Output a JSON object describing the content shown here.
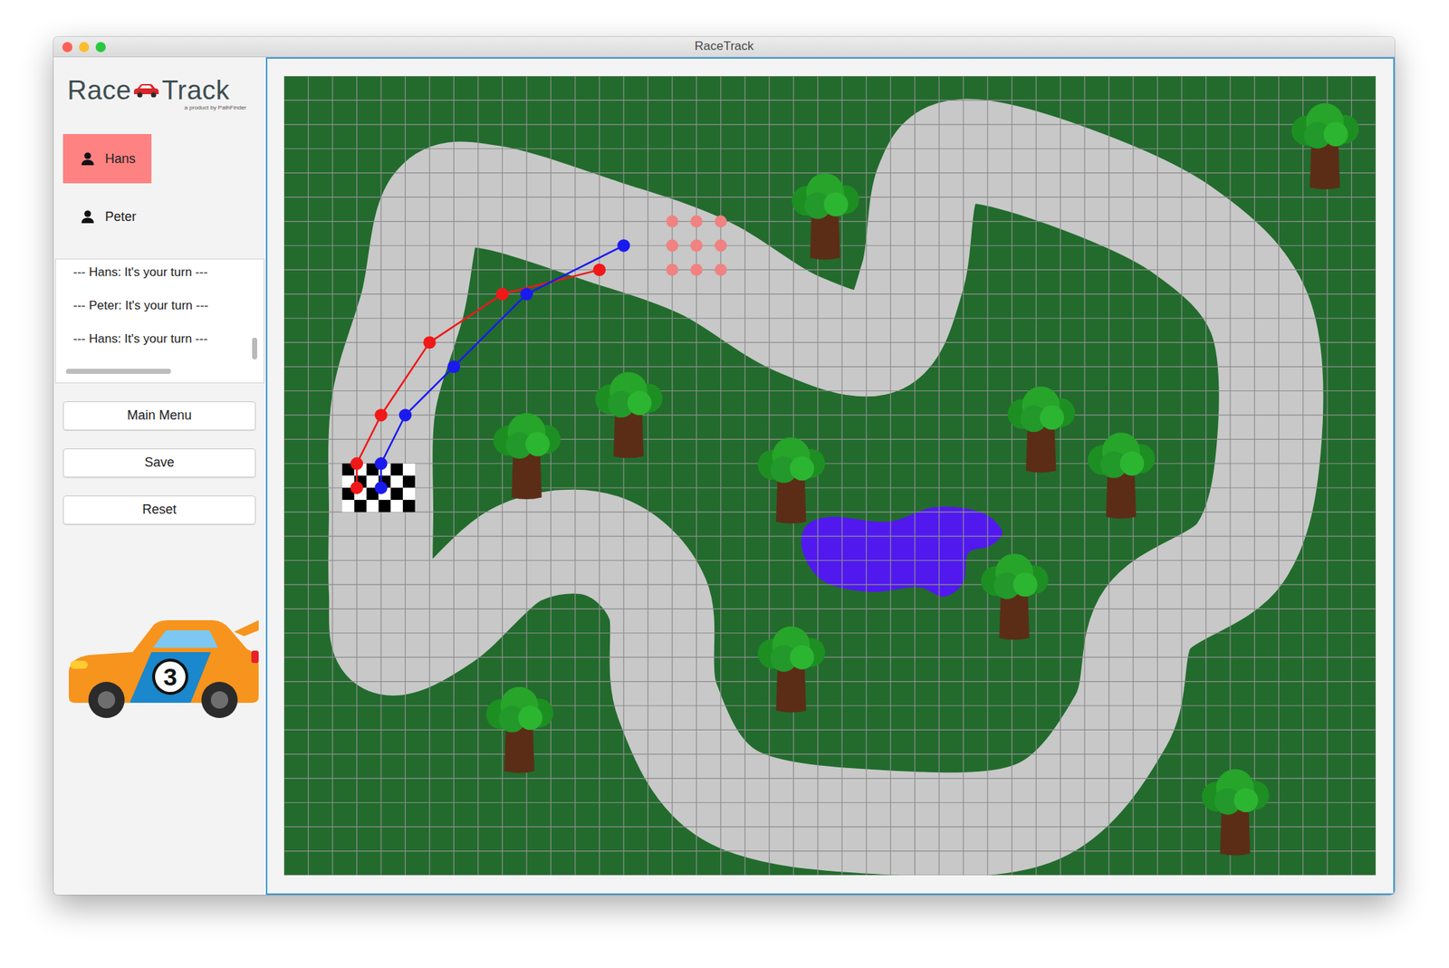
{
  "window": {
    "title": "RaceTrack"
  },
  "logo": {
    "left": "Race",
    "right": "Track",
    "tagline": "a product by PathFinder"
  },
  "players": [
    {
      "name": "Hans",
      "selected": true
    },
    {
      "name": "Peter",
      "selected": false
    }
  ],
  "log": {
    "entries": [
      "--- Hans: It's your turn ---",
      "--- Peter: It's your turn ---",
      "--- Hans: It's your turn ---"
    ],
    "vscroll": 1,
    "hscroll": 0
  },
  "buttons": [
    "Main Menu",
    "Save",
    "Reset"
  ],
  "car": {
    "number": "3"
  },
  "board": {
    "columns": 45,
    "rows": 33,
    "routes": [
      {
        "color": "#f01818",
        "points": [
          [
            3,
            17
          ],
          [
            3,
            16
          ],
          [
            4,
            14
          ],
          [
            6,
            11
          ],
          [
            9,
            9
          ],
          [
            13,
            8
          ]
        ]
      },
      {
        "color": "#1a1aef",
        "points": [
          [
            4,
            17
          ],
          [
            4,
            16
          ],
          [
            5,
            14
          ],
          [
            7,
            12
          ],
          [
            10,
            9
          ],
          [
            14,
            7
          ]
        ]
      }
    ],
    "options": {
      "color": "#f08282",
      "points": [
        [
          16,
          6
        ],
        [
          17,
          6
        ],
        [
          18,
          6
        ],
        [
          16,
          7
        ],
        [
          17,
          7
        ],
        [
          18,
          7
        ],
        [
          16,
          8
        ],
        [
          17,
          8
        ],
        [
          18,
          8
        ]
      ]
    }
  }
}
